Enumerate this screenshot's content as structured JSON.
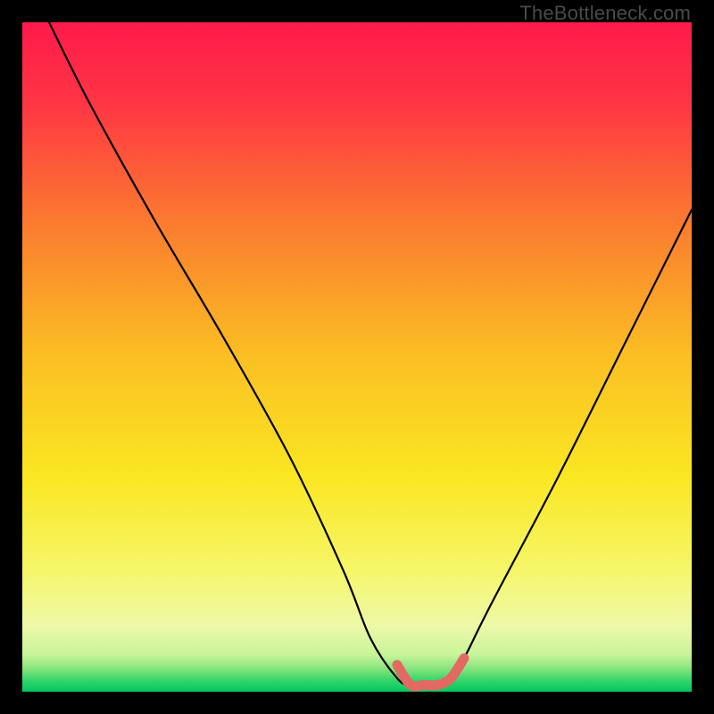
{
  "watermark": "TheBottleneck.com",
  "chart_data": {
    "type": "line",
    "title": "",
    "xlabel": "",
    "ylabel": "",
    "xlim": [
      0,
      100
    ],
    "ylim": [
      0,
      100
    ],
    "series": [
      {
        "name": "bottleneck-curve",
        "x": [
          4,
          10,
          20,
          30,
          40,
          48,
          52,
          56,
          58,
          60,
          62,
          64,
          66,
          70,
          80,
          90,
          100
        ],
        "y": [
          100,
          88,
          70,
          53,
          35,
          18,
          8,
          2,
          1,
          1,
          1,
          2,
          5,
          13,
          32,
          52,
          72
        ]
      },
      {
        "name": "optimal-band",
        "x": [
          56,
          58,
          60,
          62,
          64,
          66
        ],
        "y": [
          4,
          1,
          1,
          1,
          2,
          5
        ]
      }
    ],
    "gradient_stops": [
      {
        "offset": 0.0,
        "color": "#ff1a4b"
      },
      {
        "offset": 0.12,
        "color": "#ff3544"
      },
      {
        "offset": 0.3,
        "color": "#fb7b2f"
      },
      {
        "offset": 0.5,
        "color": "#fbbf23"
      },
      {
        "offset": 0.68,
        "color": "#fae722"
      },
      {
        "offset": 0.82,
        "color": "#f6f66a"
      },
      {
        "offset": 0.9,
        "color": "#eef9a8"
      },
      {
        "offset": 0.945,
        "color": "#c7f49a"
      },
      {
        "offset": 0.965,
        "color": "#88e57d"
      },
      {
        "offset": 0.985,
        "color": "#2fd36a"
      },
      {
        "offset": 1.0,
        "color": "#00c95f"
      }
    ],
    "optimal_band_color": "#e26a63"
  }
}
